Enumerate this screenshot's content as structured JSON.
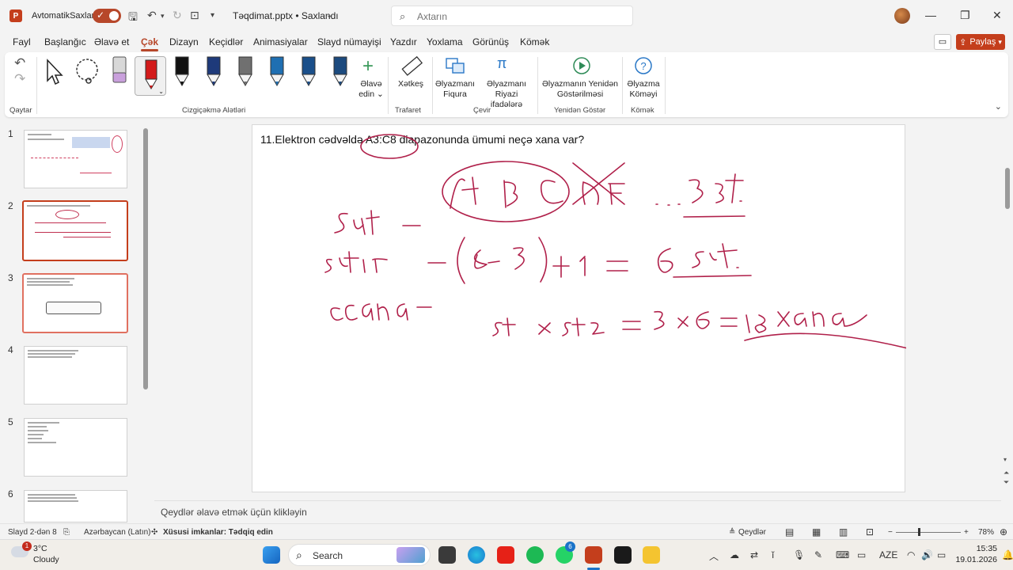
{
  "titlebar": {
    "autosave_label": "AvtomatikSaxlama",
    "doc_title": "Təqdimat.pptx • Saxlandı",
    "search_placeholder": "Axtarın"
  },
  "menu": {
    "tabs": [
      "Fayl",
      "Başlanğıc",
      "Əlavə et",
      "Çək",
      "Dizayn",
      "Keçidlər",
      "Animasiyalar",
      "Slayd nümayişi",
      "Yazdır",
      "Yoxlama",
      "Görünüş",
      "Kömək"
    ],
    "active_tab": "Çək",
    "share_label": "Paylaş"
  },
  "ribbon": {
    "groups": {
      "undo": "Qaytar",
      "drawing_tools": "Cizgiçəkmə Alətləri",
      "stencils": "Trafaret",
      "convert": "Çevir",
      "replay": "Yenidən Göstər",
      "help": "Kömək"
    },
    "buttons": {
      "add_pen_1": "Əlavə",
      "add_pen_2": "edin",
      "ruler": "Xətkeş",
      "ink_to_shape_1": "Əlyazmanı",
      "ink_to_shape_2": "Fiqura",
      "ink_to_math_1": "Əlyazmanı",
      "ink_to_math_2": "Riyazi ifadələrə",
      "ink_replay_1": "Əlyazmanın Yenidən",
      "ink_replay_2": "Göstərilməsi",
      "ink_help_1": "Əlyazma",
      "ink_help_2": "Köməyi"
    },
    "pen_colors": [
      "#111111",
      "#1e3a7a",
      "#707070",
      "#1f6fb2",
      "#1a4f8a",
      "#1c4a7e"
    ]
  },
  "slides": {
    "numbers": [
      "1",
      "2",
      "3",
      "4",
      "5",
      "6"
    ],
    "active_index": 2
  },
  "slide": {
    "question": "11.Elektron cədvəldə A3:C8 diapazonunda ümumi neçə xana var?"
  },
  "notes_placeholder": "Qeydlər əlavə etmək üçün klikləyin",
  "status": {
    "slide_counter": "Slayd 2-dən 8",
    "language": "Azərbaycan (Latın)",
    "accessibility": "Xüsusi imkanlar: Tədqiq edin",
    "notes_btn": "Qeydlər",
    "zoom": "78%"
  },
  "taskbar": {
    "weather_temp": "3°C",
    "weather_cond": "Cloudy",
    "weather_badge": "1",
    "search_label": "Search",
    "whatsapp_badge": "6",
    "language": "AZE",
    "time": "15:35",
    "date": "19.01.2026"
  }
}
